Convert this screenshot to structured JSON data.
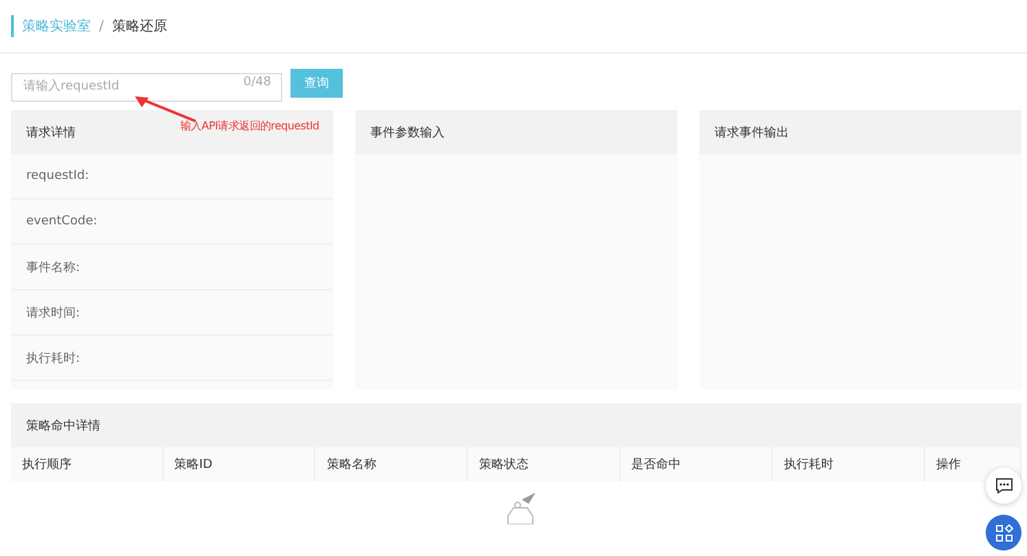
{
  "breadcrumb": [
    {
      "label": "策略实验室",
      "selected": false
    },
    {
      "label": "策略还原",
      "selected": true
    }
  ],
  "breadcrumb_separator": "/",
  "search": {
    "placeholder": "请输入requestId",
    "counter": "0/48",
    "button": "查询"
  },
  "annotation": {
    "text": "输入API请求返回的requestId"
  },
  "panels": [
    {
      "title": "请求详情",
      "fields": [
        "requestId:",
        "eventCode:",
        "事件名称:",
        "请求时间:",
        "执行耗时:"
      ]
    },
    {
      "title": "事件参数输入"
    },
    {
      "title": "请求事件输出"
    }
  ],
  "hits": {
    "title": "策略命中详情",
    "columns": [
      "执行顺序",
      "策略ID",
      "策略名称",
      "策略状态",
      "是否命中",
      "执行耗时",
      "操作"
    ]
  }
}
